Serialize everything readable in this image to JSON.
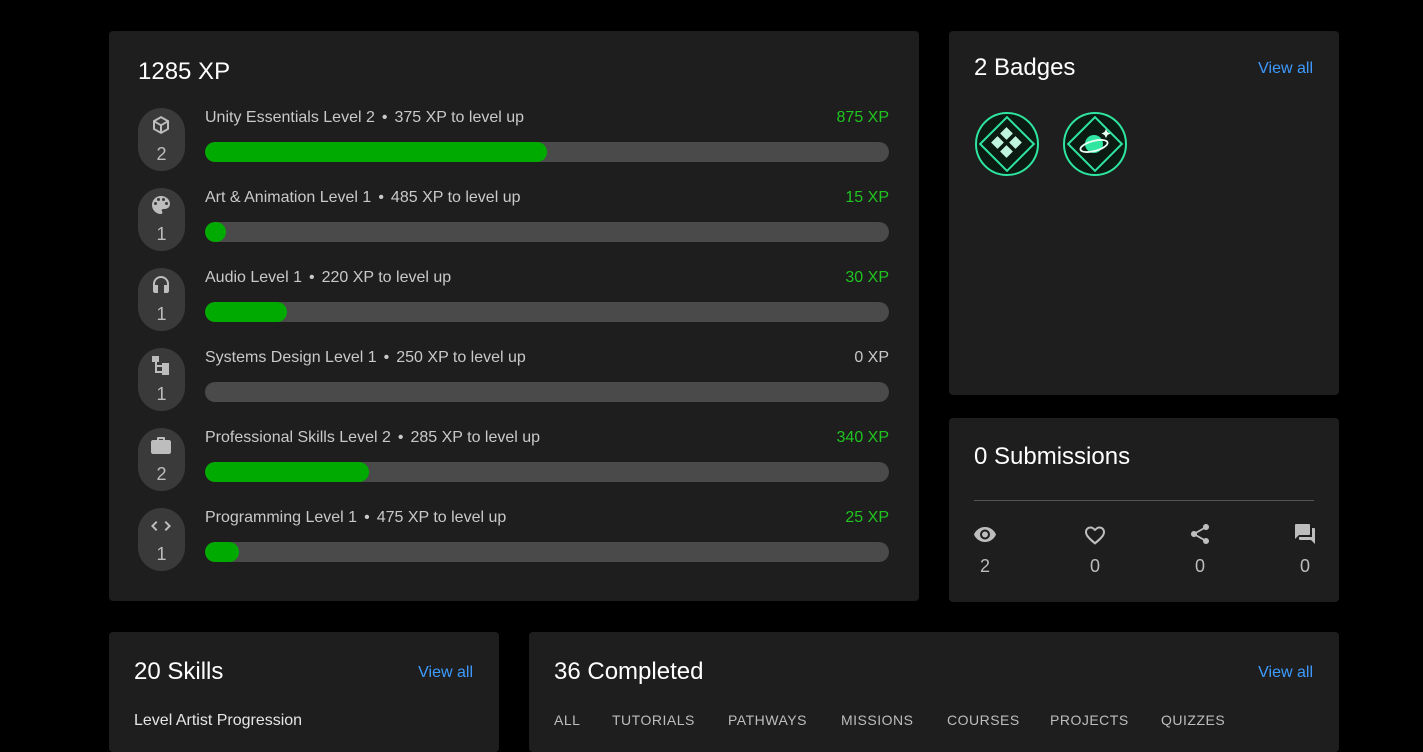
{
  "xp_card": {
    "title": "1285 XP",
    "separator": "•",
    "rows": [
      {
        "icon": "unity-cube-icon",
        "level_num": "2",
        "label": "Unity Essentials Level 2",
        "to_level": "375 XP to level up",
        "xp": "875 XP",
        "progress": 0.5
      },
      {
        "icon": "palette-icon",
        "level_num": "1",
        "label": "Art & Animation Level 1",
        "to_level": "485 XP to level up",
        "xp": "15 XP",
        "progress": 0.03
      },
      {
        "icon": "headphones-icon",
        "level_num": "1",
        "label": "Audio Level 1",
        "to_level": "220 XP to level up",
        "xp": "30 XP",
        "progress": 0.12
      },
      {
        "icon": "hierarchy-icon",
        "level_num": "1",
        "label": "Systems Design Level 1",
        "to_level": "250 XP to level up",
        "xp": "0 XP",
        "progress": 0.0
      },
      {
        "icon": "briefcase-icon",
        "level_num": "2",
        "label": "Professional Skills Level 2",
        "to_level": "285 XP to level up",
        "xp": "340 XP",
        "progress": 0.24
      },
      {
        "icon": "code-icon",
        "level_num": "1",
        "label": "Programming Level 1",
        "to_level": "475 XP to level up",
        "xp": "25 XP",
        "progress": 0.05
      }
    ],
    "colors": {
      "xp_positive": "#1fc61f",
      "xp_zero": "#c9c9c9",
      "bar_fill": "#00aa00",
      "bar_track": "#4a4a4a"
    }
  },
  "badges_card": {
    "title": "2 Badges",
    "view_all": "View all",
    "badges": [
      {
        "icon": "diamond-grid-badge-icon"
      },
      {
        "icon": "planet-badge-icon"
      }
    ],
    "accent": "#2ee6a0"
  },
  "submissions_card": {
    "title": "0 Submissions",
    "stats": [
      {
        "icon": "eye-icon",
        "value": "2"
      },
      {
        "icon": "heart-icon",
        "value": "0"
      },
      {
        "icon": "share-icon",
        "value": "0"
      },
      {
        "icon": "comment-icon",
        "value": "0"
      }
    ]
  },
  "skills_card": {
    "title": "20 Skills",
    "view_all": "View all",
    "first_item": "Level Artist Progression"
  },
  "completed_card": {
    "title": "36 Completed",
    "view_all": "View all",
    "tabs": [
      "ALL",
      "TUTORIALS",
      "PATHWAYS",
      "MISSIONS",
      "COURSES",
      "PROJECTS",
      "QUIZZES"
    ]
  },
  "link_color": "#3d9bff"
}
